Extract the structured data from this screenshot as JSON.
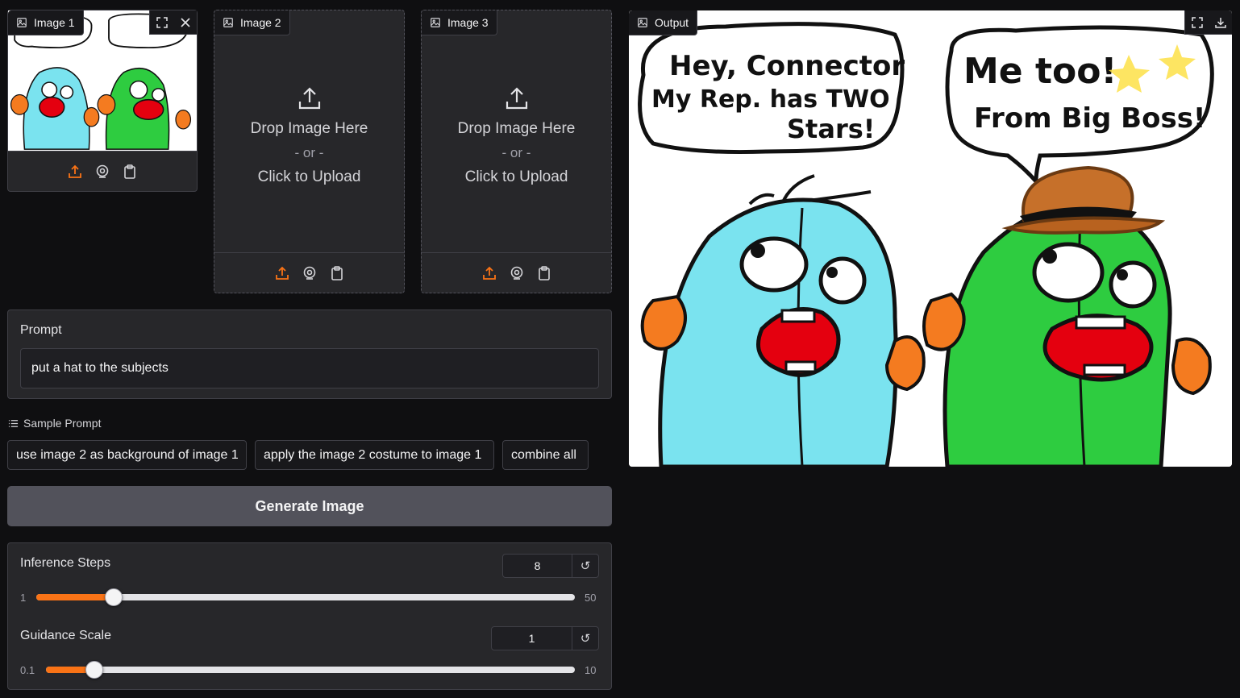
{
  "image1": {
    "label": "Image 1"
  },
  "image2": {
    "label": "Image 2",
    "drop_text": "Drop Image Here",
    "or_text": "- or -",
    "click_text": "Click to Upload"
  },
  "image3": {
    "label": "Image 3",
    "drop_text": "Drop Image Here",
    "or_text": "- or -",
    "click_text": "Click to Upload"
  },
  "output": {
    "label": "Output"
  },
  "prompt": {
    "label": "Prompt",
    "value": "put a hat to the subjects"
  },
  "samples": {
    "title": "Sample Prompt",
    "items": [
      "use image 2 as background of image 1",
      "apply the image 2 costume to image 1",
      "combine all"
    ]
  },
  "generate_label": "Generate Image",
  "inference_steps": {
    "label": "Inference Steps",
    "value": "8",
    "min": "1",
    "max": "50",
    "fraction": 0.143
  },
  "guidance_scale": {
    "label": "Guidance Scale",
    "value": "1",
    "min": "0.1",
    "max": "10",
    "fraction": 0.091
  },
  "comic": {
    "left_bubble_line1": "Hey, Connector",
    "left_bubble_line2": "My Rep. has TWO",
    "left_bubble_line3": "Stars!",
    "right_bubble_line1": "Me too!",
    "right_bubble_line2": "From Big Boss!"
  },
  "colors": {
    "accent": "#f97316",
    "background": "#0f0f11",
    "panel": "#27272a",
    "button": "#52525b"
  }
}
